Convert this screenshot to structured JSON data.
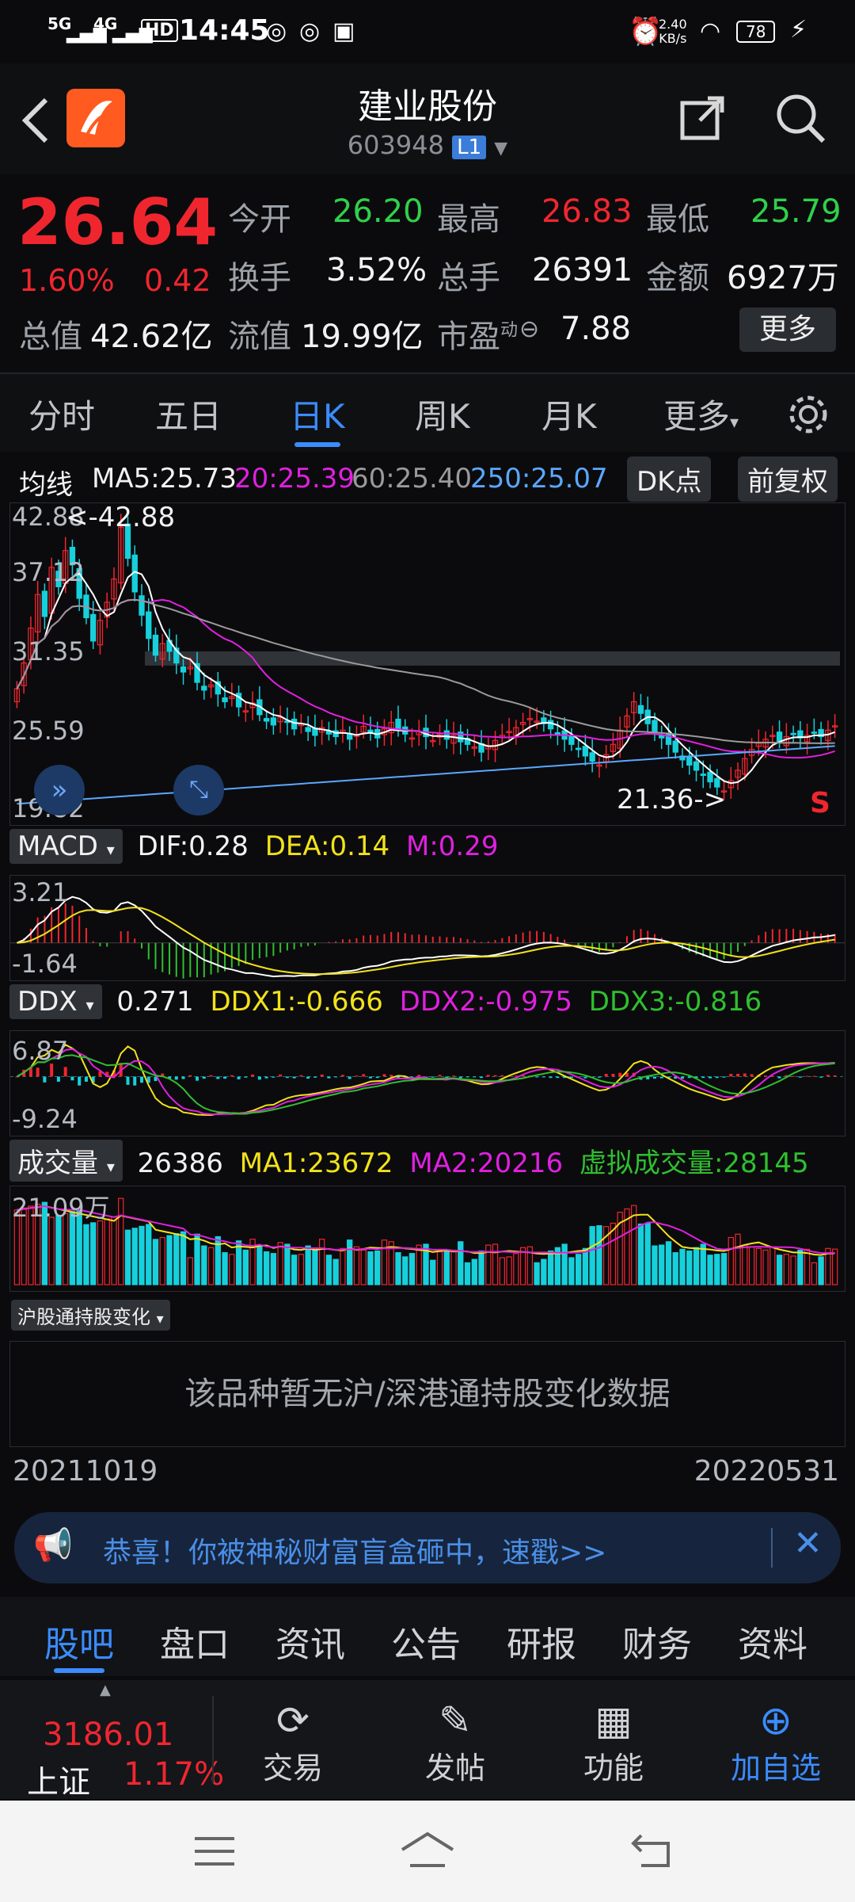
{
  "status_bar": {
    "time": "14:45",
    "network_5g": "5G",
    "network_4g": "4G",
    "hd": "HD",
    "speed_value": "2.40",
    "speed_unit": "KB/s",
    "battery": "78"
  },
  "header": {
    "title": "建业股份",
    "code": "603948",
    "level_badge": "L1"
  },
  "quote": {
    "price": "26.64",
    "change_pct": "1.60%",
    "change_abs": "0.42",
    "open_label": "今开",
    "open": "26.20",
    "high_label": "最高",
    "high": "26.83",
    "low_label": "最低",
    "low": "25.79",
    "turnover_label": "换手",
    "turnover": "3.52%",
    "volume_label": "总手",
    "volume": "26391",
    "amount_label": "金额",
    "amount": "6927万",
    "mcap_label": "总值",
    "mcap": "42.62亿",
    "float_label": "流值",
    "float_mcap": "19.99亿",
    "pe_label": "市盈",
    "pe_sup": "动",
    "pe": "7.88",
    "more_button": "更多"
  },
  "tabs": [
    "分时",
    "五日",
    "日K",
    "周K",
    "月K",
    "更多"
  ],
  "active_tab": "日K",
  "ma_line": {
    "label": "均线",
    "ma5": "MA5:25.73",
    "ma20": "20:25.39",
    "ma60": "60:25.40",
    "ma250": "250:25.07",
    "dk_button": "DK点",
    "adjust_button": "前复权"
  },
  "kline": {
    "axis_labels": [
      "42.88",
      "37.12",
      "31.35",
      "25.59",
      "19.82"
    ],
    "high_marker": "<-42.88",
    "low_marker": "21.36->",
    "signal": "S",
    "colors": {
      "up": "#f0262f",
      "down": "#16d0dc",
      "ma5": "#ffffff",
      "ma20": "#e020e0",
      "ma60": "#9a9a9a",
      "ma250": "#5aa8ff"
    },
    "close_series": [
      29.5,
      31.5,
      34.2,
      36.8,
      35.1,
      38.9,
      37.4,
      40.2,
      39.1,
      36.5,
      35.0,
      33.2,
      34.8,
      36.2,
      38.0,
      42.0,
      39.6,
      37.0,
      35.2,
      33.4,
      32.1,
      33.0,
      32.4,
      31.5,
      30.8,
      31.2,
      30.0,
      29.4,
      29.8,
      29.1,
      28.5,
      28.9,
      28.1,
      27.8,
      28.4,
      27.5,
      27.0,
      26.7,
      27.3,
      26.9,
      26.4,
      26.8,
      26.2,
      25.9,
      26.5,
      26.0,
      25.8,
      26.3,
      25.6,
      25.9,
      26.6,
      26.1,
      25.7,
      26.4,
      26.9,
      26.3,
      26.0,
      25.7,
      26.2,
      25.8,
      25.5,
      26.0,
      25.6,
      25.9,
      25.4,
      25.2,
      25.0,
      24.6,
      25.1,
      25.5,
      25.9,
      26.2,
      26.5,
      26.9,
      27.2,
      27.0,
      26.8,
      26.4,
      26.0,
      25.6,
      25.2,
      24.8,
      24.3,
      23.9,
      23.6,
      24.4,
      25.2,
      26.3,
      27.4,
      28.5,
      27.6,
      26.8,
      26.2,
      25.7,
      25.2,
      24.6,
      24.0,
      23.6,
      23.2,
      22.8,
      22.3,
      21.9,
      21.6,
      22.4,
      23.2,
      24.1,
      24.8,
      25.3,
      25.6,
      25.9,
      25.4,
      25.8,
      26.0,
      25.7,
      25.9,
      26.1,
      25.8,
      26.3,
      26.64
    ]
  },
  "macd": {
    "selector": "MACD",
    "dif": "DIF:0.28",
    "dea": "DEA:0.14",
    "m": "M:0.29",
    "axis_top": "3.21",
    "axis_bottom": "-1.64",
    "colors": {
      "dif": "#ffffff",
      "dea": "#f2e21a"
    }
  },
  "ddx": {
    "selector": "DDX",
    "ddx": "0.271",
    "ddx1": "DDX1:-0.666",
    "ddx2": "DDX2:-0.975",
    "ddx3": "DDX3:-0.816",
    "axis_top": "6.87",
    "axis_bottom": "-9.24",
    "colors": {
      "ddx1": "#f2e21a",
      "ddx2": "#e020e0",
      "ddx3": "#2fbf2f"
    }
  },
  "volume": {
    "selector": "成交量",
    "value": "26386",
    "ma1": "MA1:23672",
    "ma2": "MA2:20216",
    "virtual": "虚拟成交量:28145",
    "axis_top": "21.09万"
  },
  "hk_connect": {
    "selector": "沪股通持股变化",
    "empty_message": "该品种暂无沪/深港通持股变化数据"
  },
  "date_range": {
    "start": "20211019",
    "end": "20220531"
  },
  "banner": {
    "text": "恭喜！你被神秘财富盲盒砸中，速戳>>"
  },
  "bottom_tabs": [
    "股吧",
    "盘口",
    "资讯",
    "公告",
    "研报",
    "财务",
    "资料"
  ],
  "active_bottom_tab": "股吧",
  "dock": {
    "index_value": "3186.01",
    "index_name": "上证",
    "index_change": "1.17%",
    "trade": "交易",
    "post": "发帖",
    "functions": "功能",
    "add_watchlist": "加自选"
  }
}
